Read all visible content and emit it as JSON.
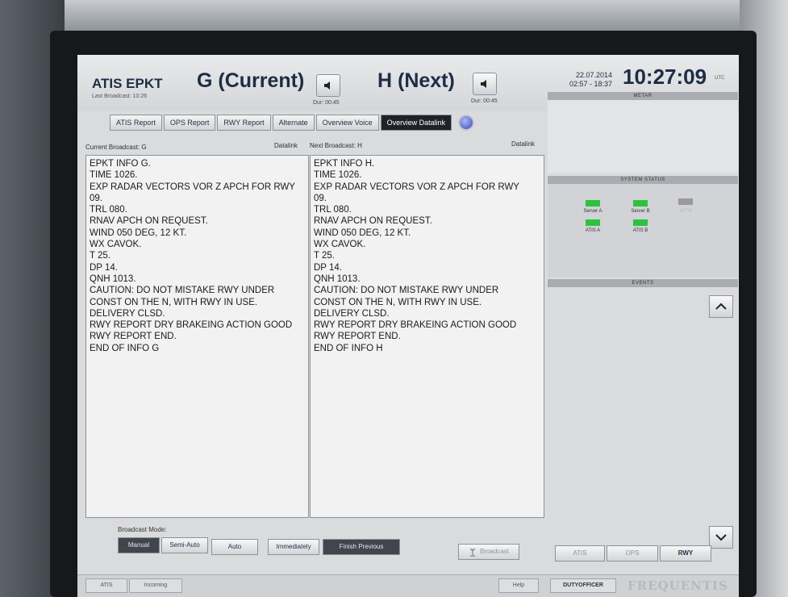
{
  "header": {
    "atis_title": "ATIS EPKT",
    "last_broadcast": "Last Broadcast: 10:26",
    "current_label": "G (Current)",
    "current_duration": "Dur: 00:45",
    "next_label": "H (Next)",
    "next_duration": "Dur: 00:45",
    "date": "22.07.2014",
    "time_range": "02:57 - 18:37",
    "clock": "10:27:09",
    "clock_unit": "UTC"
  },
  "tabs": [
    {
      "label": "ATIS Report"
    },
    {
      "label": "OPS Report"
    },
    {
      "label": "RWY Report"
    },
    {
      "label": "Alternate"
    },
    {
      "label": "Overview Voice"
    },
    {
      "label": "Overview Datalink",
      "active": true
    }
  ],
  "current": {
    "broadcast_label": "Current Broadcast:",
    "broadcast_value": "G",
    "mode": "Datalink",
    "lines": [
      "EPKT INFO G.",
      "TIME 1026.",
      "EXP RADAR VECTORS VOR Z APCH FOR RWY",
      "09.",
      "TRL 080.",
      "RNAV APCH ON REQUEST.",
      "WIND 050 DEG, 12 KT.",
      "WX CAVOK.",
      "T 25.",
      "DP 14.",
      "QNH 1013.",
      "CAUTION: DO NOT MISTAKE RWY UNDER",
      "CONST ON THE N, WITH RWY IN USE.",
      "DELIVERY CLSD.",
      "RWY REPORT DRY BRAKEING ACTION GOOD",
      "RWY REPORT END.",
      "END OF INFO G"
    ]
  },
  "next": {
    "broadcast_label": "Next Broadcast:",
    "broadcast_value": "H",
    "mode": "Datalink",
    "lines": [
      "EPKT INFO H.",
      "TIME 1026.",
      "EXP RADAR VECTORS VOR Z APCH FOR RWY",
      "09.",
      "TRL 080.",
      "RNAV APCH ON REQUEST.",
      "WIND 050 DEG, 12 KT.",
      "WX CAVOK.",
      "T 25.",
      "DP 14.",
      "QNH 1013.",
      "CAUTION: DO NOT MISTAKE RWY UNDER",
      "CONST ON THE N, WITH RWY IN USE.",
      "DELIVERY CLSD.",
      "RWY REPORT DRY BRAKEING ACTION GOOD",
      "RWY REPORT END.",
      "END OF INFO H"
    ]
  },
  "side": {
    "metar_title": "METAR",
    "system_status_title": "SYSTEM STATUS",
    "events_title": "EVENTS",
    "indicators": [
      {
        "label": "Server A",
        "color": "#2fc23f"
      },
      {
        "label": "Server B",
        "color": "#2fc23f"
      },
      {
        "label": "AFTN",
        "color": "#9a9a9a"
      },
      {
        "label": "ATIS A",
        "color": "#2fc23f"
      },
      {
        "label": "ATIS B",
        "color": "#2fc23f"
      }
    ]
  },
  "bottom": {
    "broadcast_mode_label": "Broadcast Mode:",
    "manual": "Manual",
    "semi_auto": "Semi-Auto",
    "auto": "Auto",
    "immediately": "Immediately",
    "finish_previous": "Finish Previous",
    "broadcast": "Broadcast",
    "atis": "ATIS",
    "ops": "OPS",
    "rwy": "RWY"
  },
  "statusbar": {
    "tab1": "ATIS",
    "tab2": "Incoming",
    "help": "Help",
    "user": "DUTYOFFICER",
    "brand": "FREQUENTIS"
  },
  "colors": {
    "accent": "#1e2d44",
    "led_ok": "#2fc23f",
    "led_off": "#9a9a9a"
  }
}
